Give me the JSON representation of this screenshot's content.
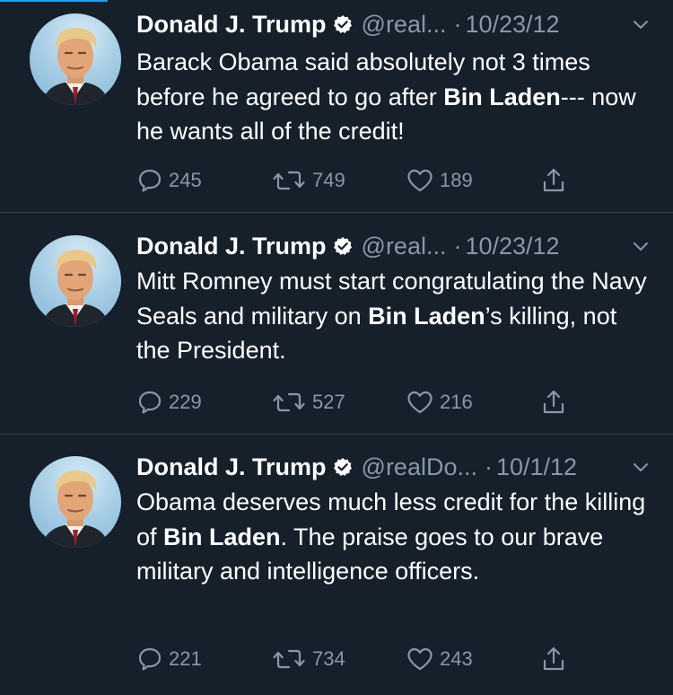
{
  "theme": {
    "background": "#15202b",
    "text": "#ffffff",
    "muted": "#8899a6",
    "divider": "#38444d",
    "accent": "#1da1f2"
  },
  "tweets": [
    {
      "name": "Donald J. Trump",
      "handle": "@real...",
      "separator": "·",
      "date": "10/23/12",
      "body": [
        {
          "t": "Barack Obama said absolutely not 3 times before he agreed to go after ",
          "b": false
        },
        {
          "t": "Bin Laden",
          "b": true
        },
        {
          "t": "--- now he wants all of the credit!",
          "b": false
        }
      ],
      "reply_count": "245",
      "retweet_count": "749",
      "like_count": "189"
    },
    {
      "name": "Donald J. Trump",
      "handle": "@real...",
      "separator": "·",
      "date": "10/23/12",
      "body": [
        {
          "t": "Mitt Romney must start congratulating the Navy Seals and military on ",
          "b": false
        },
        {
          "t": "Bin Laden",
          "b": true
        },
        {
          "t": "’s killing, not the President.",
          "b": false
        }
      ],
      "reply_count": "229",
      "retweet_count": "527",
      "like_count": "216"
    },
    {
      "name": "Donald J. Trump",
      "handle": "@realDo...",
      "separator": "·",
      "date": "10/1/12",
      "body": [
        {
          "t": "Obama deserves much less credit for the killing of ",
          "b": false
        },
        {
          "t": "Bin Laden",
          "b": true
        },
        {
          "t": ". The praise goes to our brave military and intelligence officers.",
          "b": false
        }
      ],
      "reply_count": "221",
      "retweet_count": "734",
      "like_count": "243"
    }
  ]
}
